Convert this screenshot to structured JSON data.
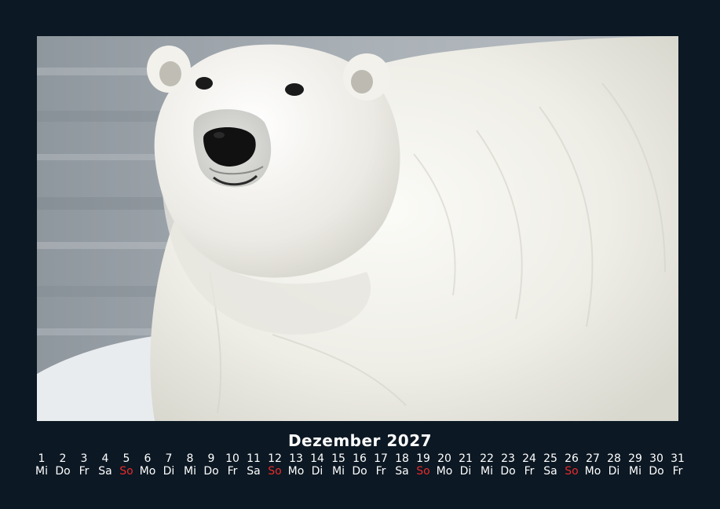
{
  "calendar": {
    "month_title": "Dezember 2027",
    "sunday_color": "#e52c2c",
    "text_color": "#ffffff",
    "background_color": "#0c1823",
    "days": [
      {
        "num": "1",
        "wd": "Mi"
      },
      {
        "num": "2",
        "wd": "Do"
      },
      {
        "num": "3",
        "wd": "Fr"
      },
      {
        "num": "4",
        "wd": "Sa"
      },
      {
        "num": "5",
        "wd": "So"
      },
      {
        "num": "6",
        "wd": "Mo"
      },
      {
        "num": "7",
        "wd": "Di"
      },
      {
        "num": "8",
        "wd": "Mi"
      },
      {
        "num": "9",
        "wd": "Do"
      },
      {
        "num": "10",
        "wd": "Fr"
      },
      {
        "num": "11",
        "wd": "Sa"
      },
      {
        "num": "12",
        "wd": "So"
      },
      {
        "num": "13",
        "wd": "Mo"
      },
      {
        "num": "14",
        "wd": "Di"
      },
      {
        "num": "15",
        "wd": "Mi"
      },
      {
        "num": "16",
        "wd": "Do"
      },
      {
        "num": "17",
        "wd": "Fr"
      },
      {
        "num": "18",
        "wd": "Sa"
      },
      {
        "num": "19",
        "wd": "So"
      },
      {
        "num": "20",
        "wd": "Mo"
      },
      {
        "num": "21",
        "wd": "Di"
      },
      {
        "num": "22",
        "wd": "Mi"
      },
      {
        "num": "23",
        "wd": "Do"
      },
      {
        "num": "24",
        "wd": "Fr"
      },
      {
        "num": "25",
        "wd": "Sa"
      },
      {
        "num": "26",
        "wd": "So"
      },
      {
        "num": "27",
        "wd": "Mo"
      },
      {
        "num": "28",
        "wd": "Di"
      },
      {
        "num": "29",
        "wd": "Mi"
      },
      {
        "num": "30",
        "wd": "Do"
      },
      {
        "num": "31",
        "wd": "Fr"
      }
    ]
  }
}
